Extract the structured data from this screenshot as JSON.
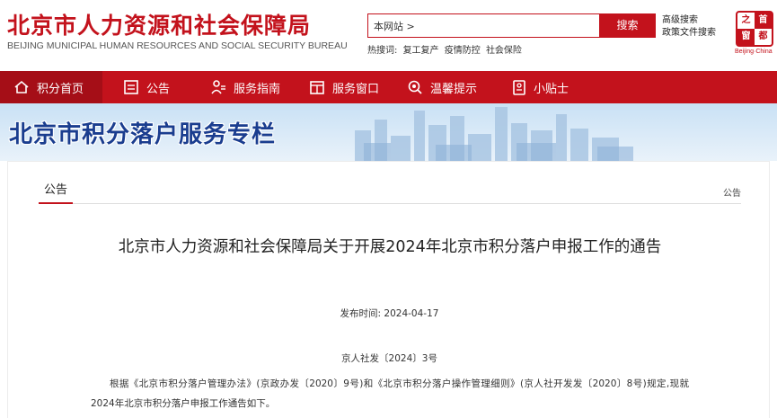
{
  "header": {
    "title": "北京市人力资源和社会保障局",
    "subtitle": "BEIJING MUNICIPAL HUMAN RESOURCES AND SOCIAL SECURITY BUREAU",
    "search_value": "本网站 >",
    "search_button": "搜索",
    "advanced_search": "高级搜索",
    "policy_search": "政策文件搜索",
    "hot_label": "热搜词:",
    "hot_words": [
      "复工复产",
      "疫情防控",
      "社会保险"
    ],
    "logo_chars": [
      "首",
      "都",
      "之",
      "窗"
    ],
    "logo_caption": "Beijing·China"
  },
  "nav": {
    "items": [
      {
        "label": "积分首页",
        "icon": "home-icon"
      },
      {
        "label": "公告",
        "icon": "notice-icon"
      },
      {
        "label": "服务指南",
        "icon": "guide-icon"
      },
      {
        "label": "服务窗口",
        "icon": "window-icon"
      },
      {
        "label": "温馨提示",
        "icon": "tips-icon"
      },
      {
        "label": "小贴士",
        "icon": "sticker-icon"
      }
    ]
  },
  "banner": {
    "title": "北京市积分落户服务专栏"
  },
  "content": {
    "tab_label": "公告",
    "breadcrumb": "公告",
    "article_title": "北京市人力资源和社会保障局关于开展2024年北京市积分落户申报工作的通告",
    "publish_label": "发布时间:",
    "publish_date": "2024-04-17",
    "doc_number": "京人社发〔2024〕3号",
    "paragraph": "根据《北京市积分落户管理办法》(京政办发〔2020〕9号)和《北京市积分落户操作管理细则》(京人社开发发〔2020〕8号)规定,现就2024年北京市积分落户申报工作通告如下。"
  },
  "colors": {
    "brand_red": "#c3121c",
    "banner_blue": "#1a3d8f"
  }
}
